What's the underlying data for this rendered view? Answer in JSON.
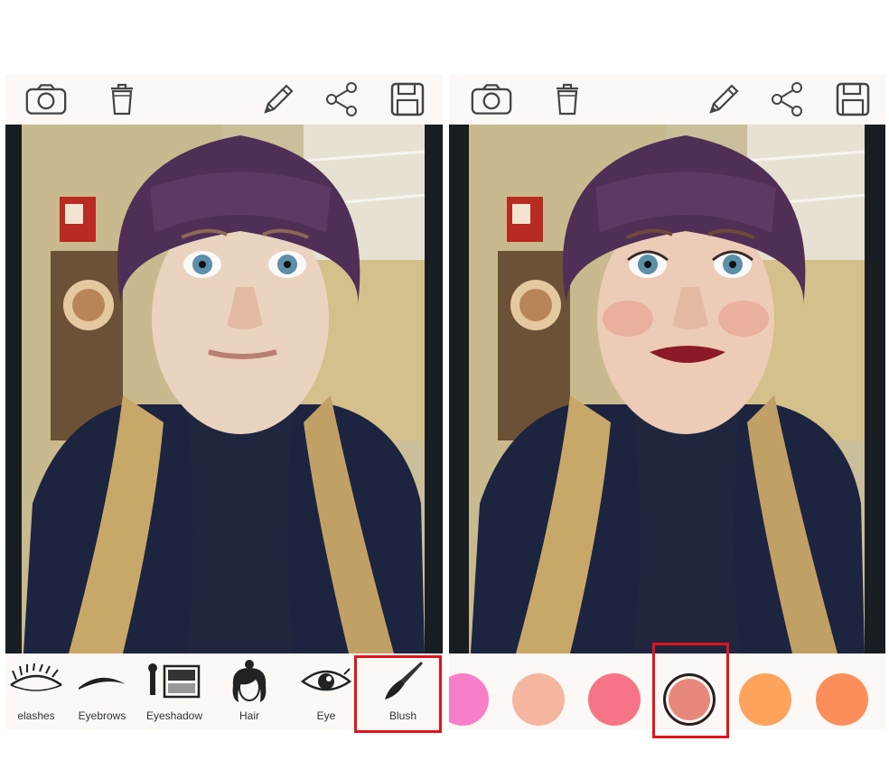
{
  "left_panel": {
    "toolbar": {
      "icons": [
        "camera-icon",
        "trash-icon",
        "pencil-icon",
        "share-icon",
        "save-icon"
      ]
    },
    "tools": [
      {
        "label": "elashes",
        "icon": "eyelashes-icon"
      },
      {
        "label": "Eyebrows",
        "icon": "eyebrow-icon"
      },
      {
        "label": "Eyeshadow",
        "icon": "eyeshadow-palette-icon"
      },
      {
        "label": "Hair",
        "icon": "hair-icon"
      },
      {
        "label": "Eye",
        "icon": "eye-icon"
      },
      {
        "label": "Blush",
        "icon": "brush-icon",
        "selected": true
      }
    ]
  },
  "right_panel": {
    "toolbar": {
      "icons": [
        "camera-icon",
        "trash-icon",
        "pencil-icon",
        "share-icon",
        "save-icon"
      ]
    },
    "swatches": [
      {
        "color": "#f77fc7"
      },
      {
        "color": "#f5b6a0"
      },
      {
        "color": "#f77487"
      },
      {
        "color": "#e8887c",
        "selected": true
      },
      {
        "color": "#fda35c"
      },
      {
        "color": "#fc8e5c"
      }
    ]
  },
  "colors": {
    "highlight": "#e0141b",
    "panel_bg": "#fbf8f5"
  }
}
